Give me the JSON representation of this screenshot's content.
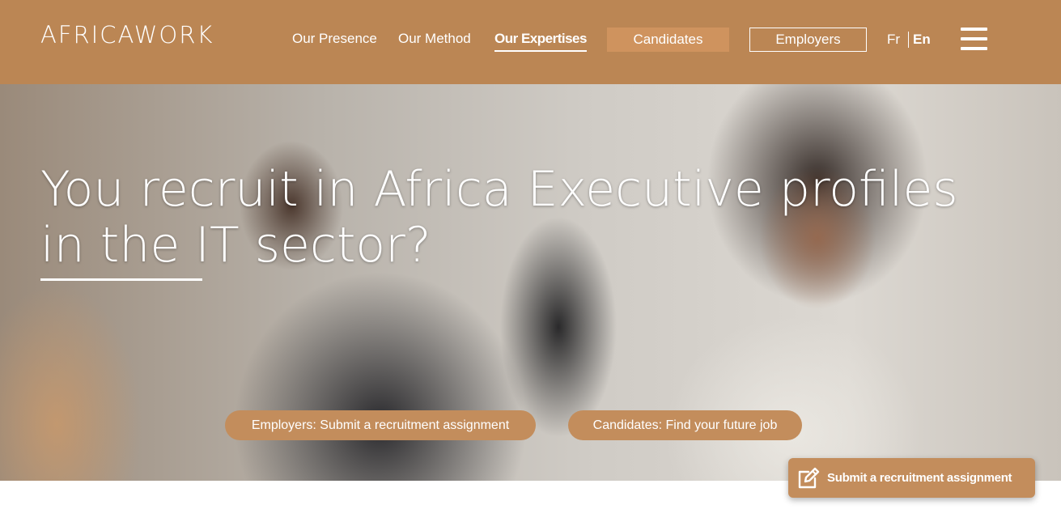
{
  "brand": {
    "logo_text": "AFRICAWORK"
  },
  "nav": {
    "items": [
      {
        "label": "Our Presence"
      },
      {
        "label": "Our Method"
      },
      {
        "label": "Our Expertises",
        "active": true
      }
    ],
    "candidates_label": "Candidates",
    "employers_label": "Employers",
    "lang_fr": "Fr",
    "lang_en": "En",
    "menu_icon": "hamburger-menu-icon"
  },
  "hero": {
    "title": "You recruit in Africa Executive profiles in the IT sector?",
    "employers_cta": "Employers: Submit a recruitment assignment",
    "candidates_cta": "Candidates: Find your future job"
  },
  "floating_action": {
    "label": "Submit a recruitment assignment",
    "icon": "edit-icon"
  },
  "colors": {
    "brand": "#bb8654",
    "button_fill": "#cf935e",
    "pill_fill": "#c38d5c",
    "text": "#ffffff"
  }
}
